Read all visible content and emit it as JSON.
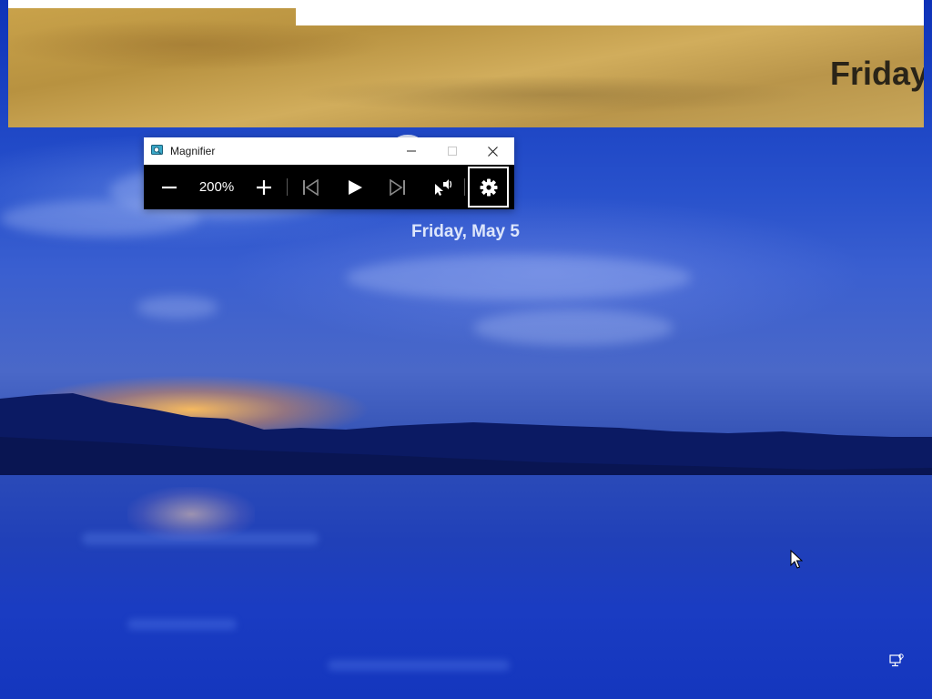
{
  "lockscreen": {
    "time_partial": "8",
    "date": "Friday, May 5"
  },
  "magnified_view": {
    "text": "Friday"
  },
  "magnifier": {
    "title": "Magnifier",
    "zoom_level": "200%",
    "icons": {
      "app": "magnifier-app-icon",
      "minimize": "minimize-icon",
      "maximize": "maximize-icon",
      "close": "close-icon",
      "zoom_out": "minus-icon",
      "zoom_in": "plus-icon",
      "previous": "skip-previous-icon",
      "play": "play-icon",
      "next": "skip-next-icon",
      "read_from_here": "read-from-here-icon",
      "settings": "gear-icon"
    }
  },
  "colors": {
    "toolbar_bg": "#000000",
    "titlebar_bg": "#ffffff",
    "sky_top": "#0e32b8",
    "magnified_tone": "#c9a24a"
  },
  "tray": {
    "network_icon": "network-icon"
  }
}
